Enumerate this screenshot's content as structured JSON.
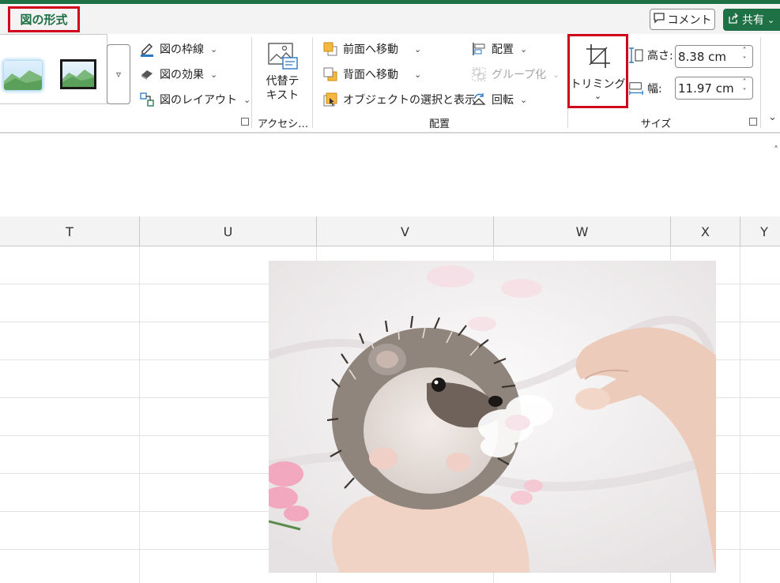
{
  "app": {
    "accent": "#1e7145",
    "highlight": "#d0021b"
  },
  "tabs": {
    "active_label": "図の形式"
  },
  "header": {
    "comment_label": "コメント",
    "share_label": "共有"
  },
  "styles_group": {
    "commands": [
      {
        "label": "図の枠線",
        "icon": "picture-border-icon"
      },
      {
        "label": "図の効果",
        "icon": "picture-effects-icon"
      },
      {
        "label": "図のレイアウト",
        "icon": "picture-layout-icon"
      }
    ]
  },
  "accessibility_group": {
    "alt_text_label_1": "代替テ",
    "alt_text_label_2": "キスト",
    "group_label": "アクセシ…"
  },
  "arrange_group": {
    "group_label": "配置",
    "commands": [
      {
        "label": "前面へ移動",
        "icon": "bring-forward-icon"
      },
      {
        "label": "背面へ移動",
        "icon": "send-backward-icon"
      },
      {
        "label": "オブジェクトの選択と表示",
        "icon": "selection-pane-icon"
      },
      {
        "label": "配置",
        "icon": "align-icon"
      },
      {
        "label": "グループ化",
        "icon": "group-icon",
        "disabled": true
      },
      {
        "label": "回転",
        "icon": "rotate-icon"
      }
    ]
  },
  "size_group": {
    "group_label": "サイズ",
    "crop_label": "トリミング",
    "height_label": "高さ:",
    "height_value": "8.38 cm",
    "width_label": "幅:",
    "width_value": "11.97 cm"
  },
  "columns": [
    "T",
    "U",
    "V",
    "W",
    "X",
    "Y"
  ],
  "image": {
    "subject": "hedgehog-photo"
  }
}
